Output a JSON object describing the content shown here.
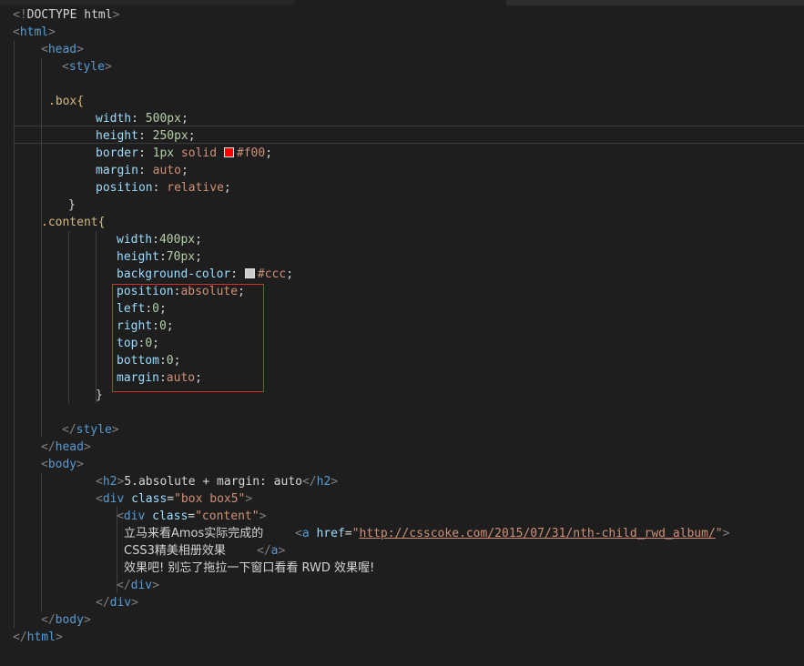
{
  "lines": [
    {
      "doctype_open": "<!",
      "doctype_text": "DOCTYPE html",
      "doctype_close": ">"
    },
    {
      "tag": "html"
    },
    {
      "tag": "head"
    },
    {
      "tag": "style"
    },
    {},
    {
      "selector": ".box{"
    },
    {
      "prop": "width",
      "colon": ": ",
      "value": "500px",
      "semi": ";"
    },
    {
      "prop": "height",
      "colon": ": ",
      "value": "250px",
      "semi": ";"
    },
    {
      "prop": "border",
      "colon": ": ",
      "v1": "1px",
      "v2": " solid ",
      "color_text": "#f00",
      "semi": ";"
    },
    {
      "prop": "margin",
      "colon": ": ",
      "value": "auto",
      "semi": ";"
    },
    {
      "prop": "position",
      "colon": ": ",
      "value": "relative",
      "semi": ";"
    },
    {
      "brace": "}"
    },
    {
      "selector": ".content{"
    },
    {
      "prop": "width",
      "colon": ":",
      "value": "400px",
      "semi": ";"
    },
    {
      "prop": "height",
      "colon": ":",
      "value": "70px",
      "semi": ";"
    },
    {
      "prop": "background-color",
      "colon": ": ",
      "color_text": "#ccc",
      "semi": ";"
    },
    {
      "prop": "position",
      "colon": ":",
      "value": "absolute",
      "semi": ";"
    },
    {
      "prop": "left",
      "colon": ":",
      "value": "0",
      "semi": ";"
    },
    {
      "prop": "right",
      "colon": ":",
      "value": "0",
      "semi": ";"
    },
    {
      "prop": "top",
      "colon": ":",
      "value": "0",
      "semi": ";"
    },
    {
      "prop": "bottom",
      "colon": ":",
      "value": "0",
      "semi": ";"
    },
    {
      "prop": "margin",
      "colon": ":",
      "value": "auto",
      "semi": ";"
    },
    {
      "brace": "}"
    },
    {},
    {
      "tag": "style"
    },
    {
      "tag": "head"
    },
    {
      "tag": "body"
    },
    {
      "tag": "h2",
      "text": "5.absolute + margin: auto",
      "close_tag": "h2"
    },
    {
      "tag": "div",
      "attr": "class",
      "eq": "=",
      "val": "\"box box5\""
    },
    {
      "tag": "div",
      "attr": "class",
      "eq": "=",
      "val": "\"content\""
    },
    {
      "text": "立马来看Amos实际完成的",
      "tag": "a",
      "attr": "href",
      "eq": "=",
      "q": "\"",
      "url": "http://csscoke.com/2015/07/31/nth-child_rwd_album/"
    },
    {
      "text": "CSS3精美相册效果",
      "close_tag": "a"
    },
    {
      "text": "效果吧! 别忘了拖拉一下窗口看看 RWD 效果喔!"
    },
    {
      "close_tag": "div"
    },
    {
      "close_tag": "div"
    },
    {
      "close_tag": "body"
    },
    {
      "close_tag": "html"
    }
  ],
  "swatches": {
    "red": "#ff0000",
    "gray": "#cccccc"
  },
  "colors": {
    "background": "#1e1e1e",
    "highlight_border": "#d0302a"
  }
}
